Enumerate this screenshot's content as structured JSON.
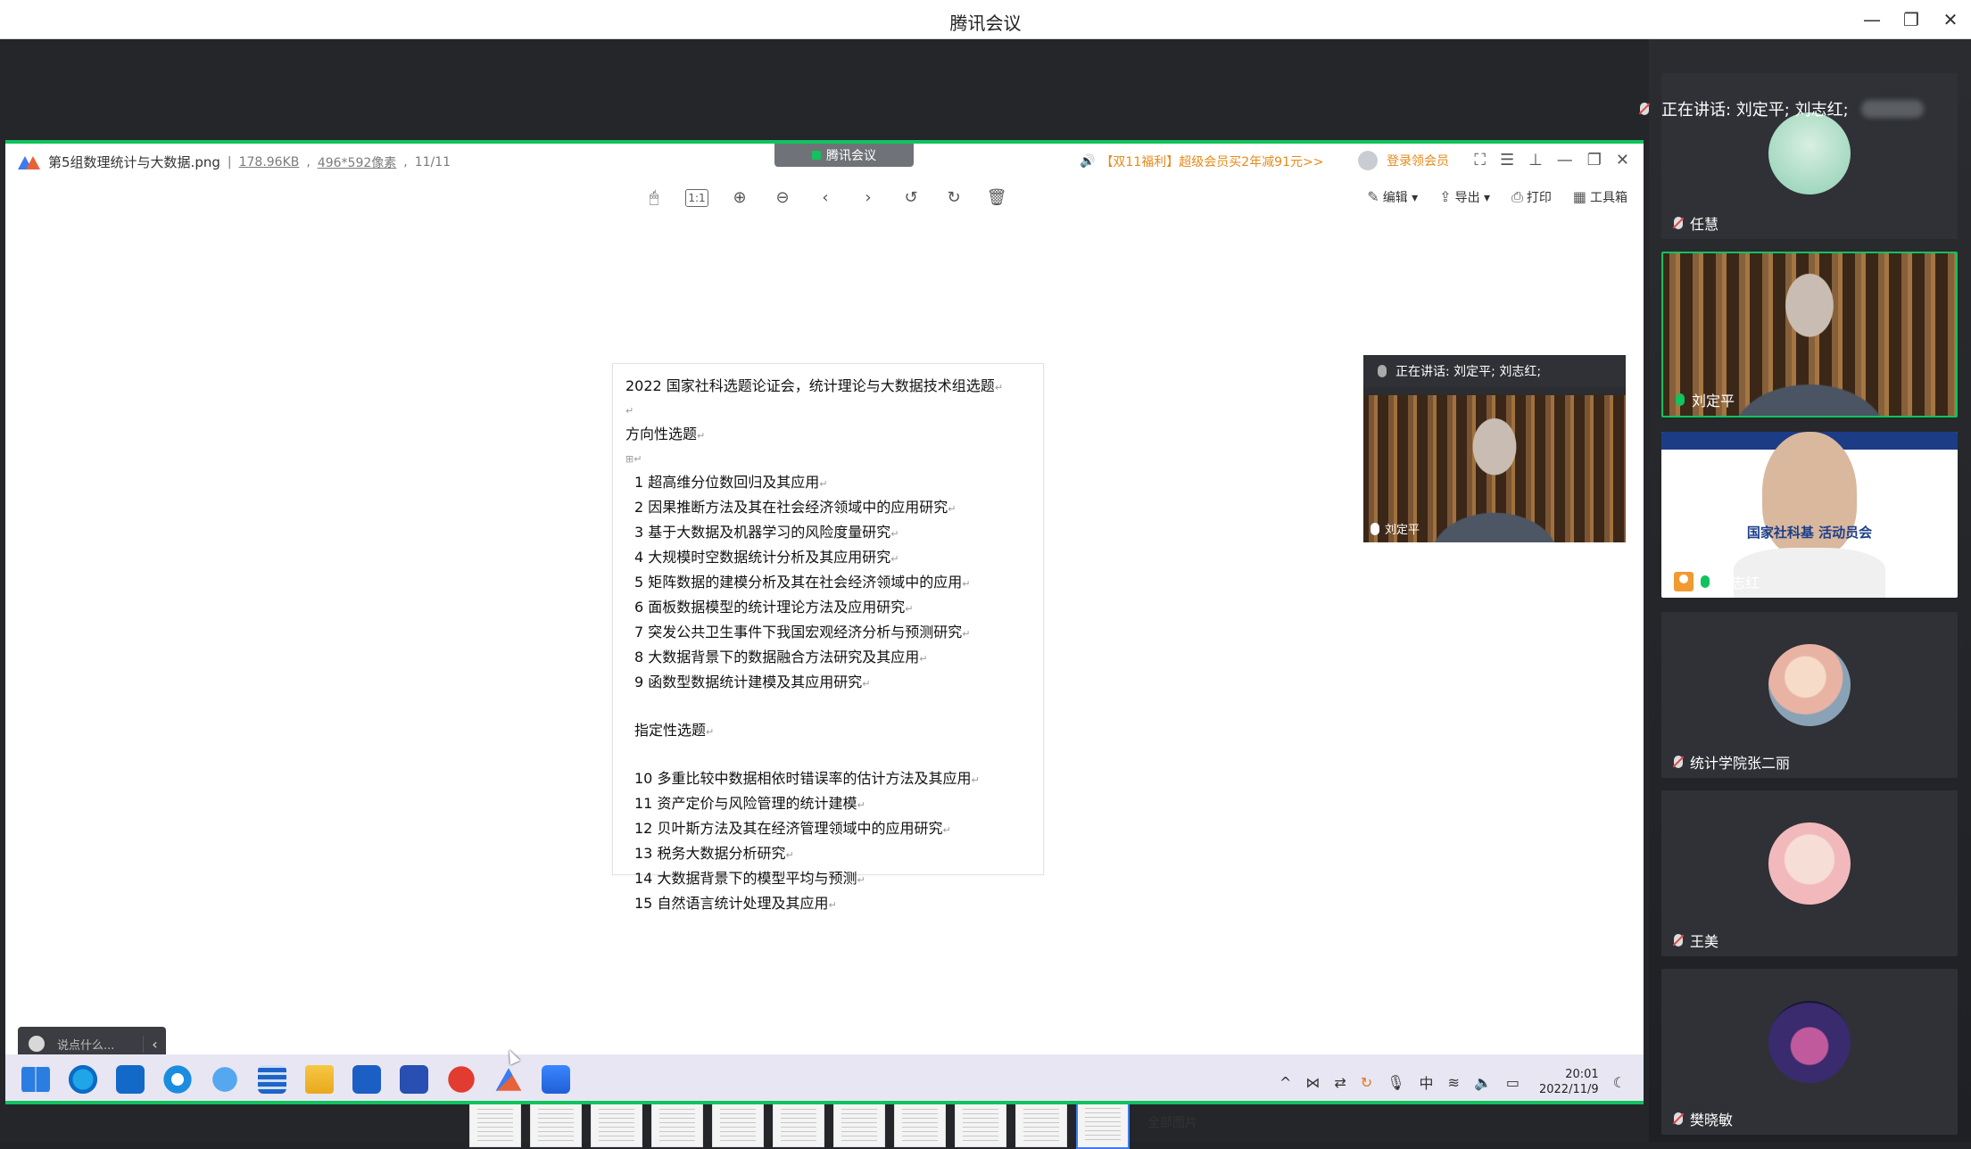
{
  "app": {
    "title": "腾讯会议",
    "minimize": "—",
    "restore": "❐",
    "close": "✕"
  },
  "viewer": {
    "file_name": "第5组数理统计与大数据.png",
    "file_size": "178.96KB",
    "dimensions": "496*592像素",
    "page_index": "11/11",
    "meeting_badge": "腾讯会议",
    "promo": "【双11福利】超级会员买2年减91元>>",
    "login": "登录领会员",
    "tools": {
      "edit": "编辑",
      "export": "导出",
      "print": "打印",
      "toolbox": "工具箱"
    },
    "all_pictures": "全部图片"
  },
  "document": {
    "title": "2022 国家社科选题论证会，统计理论与大数据技术组选题",
    "section1": "方向性选题",
    "items1": [
      "1  超高维分位数回归及其应用",
      "2  因果推断方法及其在社会经济领域中的应用研究",
      "3  基于大数据及机器学习的风险度量研究",
      "4  大规模时空数据统计分析及其应用研究",
      "5  矩阵数据的建模分析及其在社会经济领域中的应用",
      "6  面板数据模型的统计理论方法及应用研究",
      "7  突发公共卫生事件下我国宏观经济分析与预测研究",
      "8  大数据背景下的数据融合方法研究及其应用",
      "9  函数型数据统计建模及其应用研究"
    ],
    "section2": "指定性选题",
    "items2": [
      "10  多重比较中数据相依时错误率的估计方法及其应用",
      "11  资产定价与风险管理的统计建模",
      "12  贝叶斯方法及其在经济管理领域中的应用研究",
      "13  税务大数据分析研究",
      "14  大数据背景下的模型平均与预测",
      "15  自然语言统计处理及其应用"
    ]
  },
  "float_video": {
    "speaking": "正在讲话: 刘定平; 刘志红;",
    "name": "刘定平"
  },
  "chat": {
    "placeholder": "说点什么..."
  },
  "taskbar": {
    "time": "20:01",
    "date": "2022/11/9"
  },
  "panel": {
    "speaking": "正在讲话: 刘定平; 刘志红;",
    "participants": [
      {
        "name": "任慧"
      },
      {
        "name": "刘定平"
      },
      {
        "name": "刘志红",
        "banner": "国家社科基                 活动员会"
      },
      {
        "name": "统计学院张二丽"
      },
      {
        "name": "王美"
      },
      {
        "name": "樊晓敏"
      }
    ]
  },
  "colors": {
    "share_border": "#10c35e",
    "promo": "#e58a1a",
    "active_thumb": "#3f7cf0"
  }
}
